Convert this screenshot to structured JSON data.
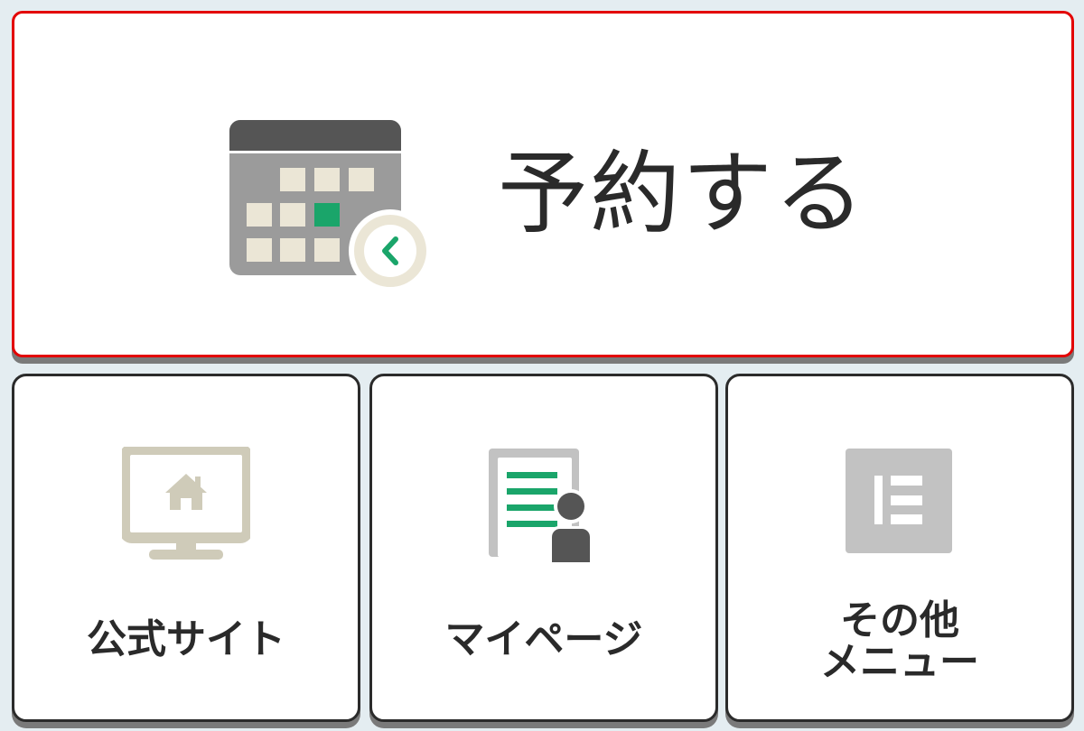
{
  "main_button": {
    "label": "予約する",
    "icon": "calendar-icon"
  },
  "tiles": [
    {
      "label": "公式サイト",
      "icon": "monitor-home-icon"
    },
    {
      "label": "マイページ",
      "icon": "profile-document-icon"
    },
    {
      "label_line1": "その他",
      "label_line2": "メニュー",
      "icon": "menu-icon"
    }
  ],
  "colors": {
    "accent_green": "#1aa56a",
    "highlight_border": "#e30000",
    "card_border": "#2b2b2b",
    "icon_gray": "#9b9b9b",
    "icon_beige": "#ebe6d6",
    "background": "#e4edf1"
  }
}
